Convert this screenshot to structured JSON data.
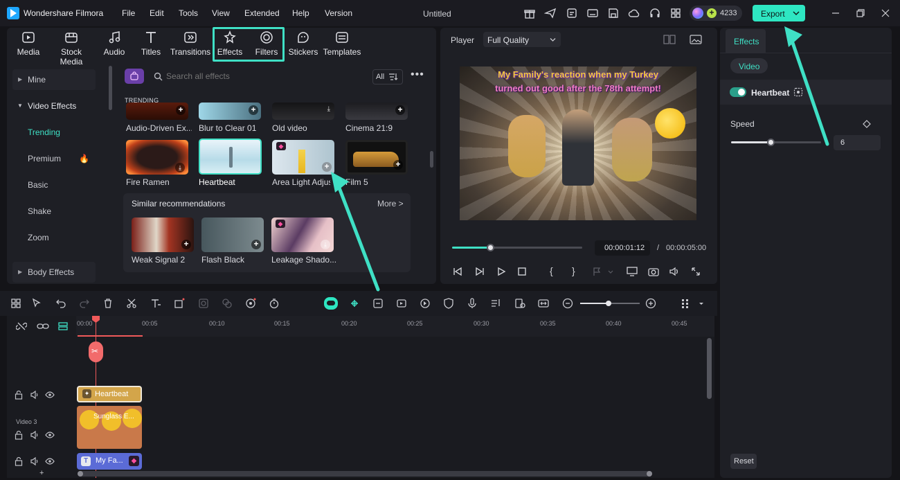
{
  "app": {
    "name": "Wondershare Filmora",
    "project_title": "Untitled"
  },
  "menu": [
    "File",
    "Edit",
    "Tools",
    "View",
    "Extended",
    "Help",
    "Version"
  ],
  "credits": "4233",
  "export_label": "Export",
  "toolbar_tabs": [
    "Media",
    "Stock Media",
    "Audio",
    "Titles",
    "Transitions",
    "Effects",
    "Filters",
    "Stickers",
    "Templates"
  ],
  "sidebar": {
    "mine": "Mine",
    "video_effects": "Video Effects",
    "items": [
      "Trending",
      "Premium",
      "Basic",
      "Shake",
      "Zoom"
    ],
    "body_effects": "Body Effects"
  },
  "search": {
    "placeholder": "Search all effects",
    "filter_label": "All"
  },
  "section_title": "TRENDING",
  "row1": [
    "Audio-Driven Ex...",
    "Blur to Clear 01",
    "Old video",
    "Cinema 21:9"
  ],
  "row2": [
    "Fire Ramen",
    "Heartbeat",
    "Area Light Adjus",
    "Film 5"
  ],
  "similar": {
    "title": "Similar recommendations",
    "more": "More >",
    "items": [
      "Weak Signal 2",
      "Flash Black",
      "Leakage Shado..."
    ]
  },
  "player": {
    "label": "Player",
    "quality": "Full Quality",
    "overlay_line1": "My Family's reaction when my Turkey",
    "overlay_line2": "turned out good after the 78th attempt!",
    "current_time": "00:00:01:12",
    "separator": "/",
    "total_time": "00:00:05:00",
    "progress": 0.3
  },
  "right_panel": {
    "tab": "Effects",
    "subtab": "Video",
    "effect_name": "Heartbeat",
    "speed_label": "Speed",
    "speed_value": "6",
    "reset_label": "Reset"
  },
  "timeline": {
    "ruler": [
      "00:00",
      "00:05",
      "00:10",
      "00:15",
      "00:20",
      "00:25",
      "00:30",
      "00:35",
      "00:40",
      "00:45"
    ],
    "effect_clip": "Heartbeat",
    "video_clip": "Sunglass E...",
    "track_label": "Video 3",
    "title_clip": "My Fa..."
  },
  "colors": {
    "accent": "#3fe0c5",
    "export_bg": "#2ee6c2",
    "playhead": "#f05a5a"
  }
}
